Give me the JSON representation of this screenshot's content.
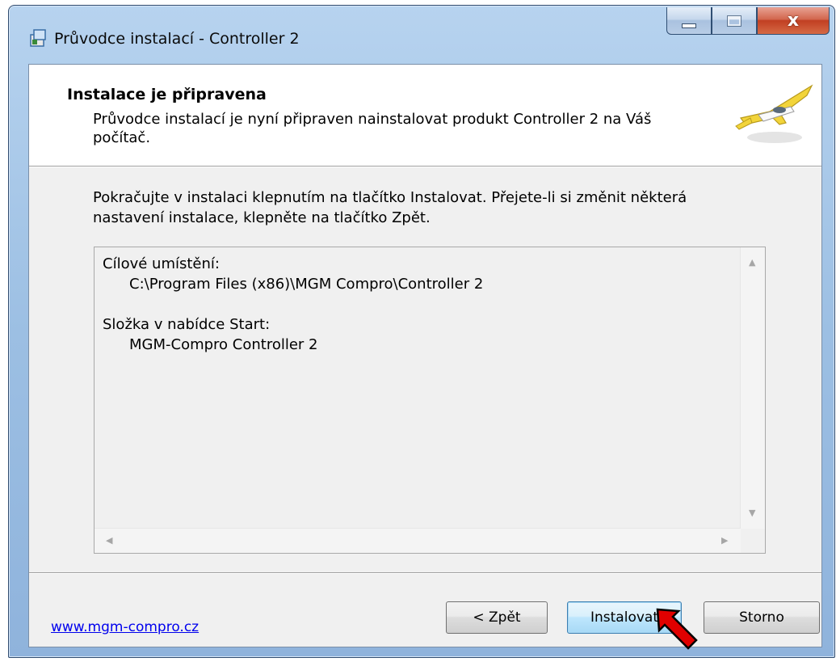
{
  "window": {
    "title": "Průvodce instalací - Controller 2",
    "close_glyph": "x"
  },
  "header": {
    "title": "Instalace je připravena",
    "description": "Průvodce instalací je nyní připraven nainstalovat produkt Controller 2 na Váš počítač."
  },
  "body": {
    "intro": "Pokračujte v instalaci klepnutím na tlačítko Instalovat. Přejete-li si změnit některá nastavení instalace, klepněte na tlačítko Zpět.",
    "summary": {
      "destination_label": "Cílové umístění:",
      "destination_value": "C:\\Program Files (x86)\\MGM Compro\\Controller 2",
      "start_menu_label": "Složka v nabídce Start:",
      "start_menu_value": "MGM-Compro Controller 2"
    }
  },
  "footer": {
    "link": "www.mgm-compro.cz",
    "back_button": "< Zpět",
    "install_button": "Instalovat",
    "cancel_button": "Storno"
  },
  "icons": {
    "app": "installer-icon",
    "header_image": "airplane-icon",
    "annotation": "red-arrow-icon"
  },
  "colors": {
    "link": "#0000ee",
    "annotation_arrow": "#e00000"
  }
}
